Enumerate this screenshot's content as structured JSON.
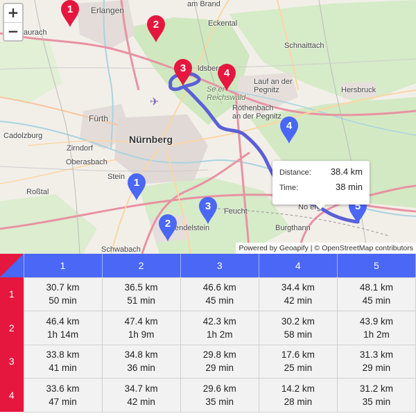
{
  "map": {
    "zoom_in_label": "+",
    "zoom_out_label": "−",
    "places": {
      "erlangen": "Erlangen",
      "herzogenaurach": "zogenaurach",
      "am_brand": "am Brand",
      "eckental": "Eckental",
      "schnaittach": "Schnaittach",
      "heroldsberg": "ldsberg",
      "reichswald": "Se    er Reichswald",
      "lauf": "Lauf an der Pegnitz",
      "hersbruck": "Hersbruck",
      "rothenbach": "Röthenbach an der Pegnitz",
      "fuerth": "Fürth",
      "nuernberg": "Nürnberg",
      "cadolzburg": "Cadolzburg",
      "zirndorf": "Zirndorf",
      "oberasbach": "Oberasbach",
      "stein": "Stein",
      "rosstal": "Roßtal",
      "feucht": "Feucht",
      "wendelstein": "endelstein",
      "schwabach": "Schwabach",
      "burgthann": "Burgthann",
      "neumarkt": "No     erg"
    },
    "red_markers": [
      "1",
      "2",
      "3",
      "4"
    ],
    "blue_markers": [
      "1",
      "2",
      "3",
      "4",
      "5"
    ],
    "colors": {
      "red_marker": "#e5173f",
      "blue_marker": "#4a67f5",
      "route": "#5b5fd6"
    },
    "tooltip": {
      "distance_label": "Distance:",
      "distance_value": "38.4 km",
      "time_label": "Time:",
      "time_value": "38 min"
    },
    "attribution": {
      "powered_by": "Powered by",
      "geoapify": "Geoapify",
      "separator": " | © ",
      "osm": "OpenStreetMap",
      "contributors": " contributors"
    }
  },
  "matrix": {
    "columns": [
      "1",
      "2",
      "3",
      "4",
      "5"
    ],
    "rows": [
      {
        "label": "1",
        "cells": [
          [
            "30.7 km",
            "50 min"
          ],
          [
            "36.5 km",
            "51 min"
          ],
          [
            "46.6 km",
            "45 min"
          ],
          [
            "34.4 km",
            "42 min"
          ],
          [
            "48.1 km",
            "45 min"
          ]
        ]
      },
      {
        "label": "2",
        "cells": [
          [
            "46.4 km",
            "1h 14m"
          ],
          [
            "47.4 km",
            "1h 9m"
          ],
          [
            "42.3 km",
            "1h 2m"
          ],
          [
            "30.2 km",
            "58 min"
          ],
          [
            "43.9 km",
            "1h 2m"
          ]
        ]
      },
      {
        "label": "3",
        "cells": [
          [
            "33.8 km",
            "41 min"
          ],
          [
            "34.8 km",
            "36 min"
          ],
          [
            "29.8 km",
            "29 min"
          ],
          [
            "17.6 km",
            "25 min"
          ],
          [
            "31.3 km",
            "29 min"
          ]
        ]
      },
      {
        "label": "4",
        "cells": [
          [
            "33.6 km",
            "47 min"
          ],
          [
            "34.7 km",
            "42 min"
          ],
          [
            "29.6 km",
            "35 min"
          ],
          [
            "14.2 km",
            "28 min"
          ],
          [
            "31.2 km",
            "35 min"
          ]
        ]
      }
    ]
  }
}
